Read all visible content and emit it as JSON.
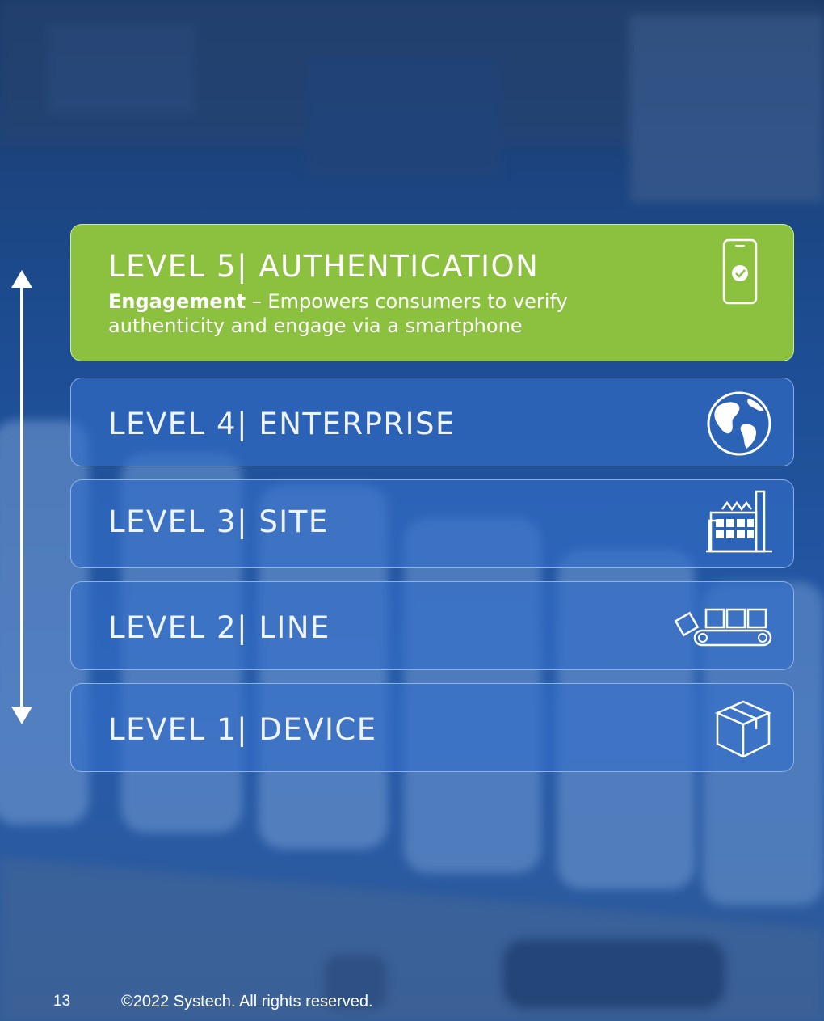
{
  "levels": [
    {
      "title": "LEVEL 5| AUTHENTICATION",
      "desc_bold": "Engagement",
      "desc_rest": " – Empowers consumers to verify authenticity and engage via a smartphone",
      "icon": "smartphone-check-icon"
    },
    {
      "title": "LEVEL 4| ENTERPRISE",
      "icon": "globe-icon"
    },
    {
      "title": "LEVEL 3| SITE",
      "icon": "factory-icon"
    },
    {
      "title": "LEVEL 2| LINE",
      "icon": "conveyor-icon"
    },
    {
      "title": "LEVEL 1| DEVICE",
      "icon": "package-box-icon"
    }
  ],
  "footer": {
    "page_number": "13",
    "copyright": "©2022 Systech. All rights reserved."
  },
  "colors": {
    "active_level": "#8cc13f",
    "inactive_level": "#346ec8",
    "background": "#1c3a66"
  }
}
